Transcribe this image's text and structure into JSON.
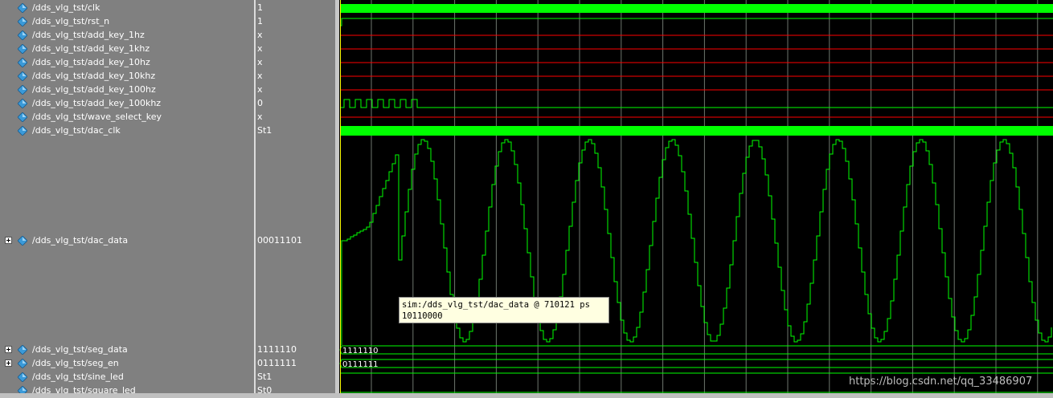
{
  "signals": [
    {
      "name": "/dds_vlg_tst/clk",
      "value": "1",
      "expandable": false
    },
    {
      "name": "/dds_vlg_tst/rst_n",
      "value": "1",
      "expandable": false
    },
    {
      "name": "/dds_vlg_tst/add_key_1hz",
      "value": "x",
      "expandable": false
    },
    {
      "name": "/dds_vlg_tst/add_key_1khz",
      "value": "x",
      "expandable": false
    },
    {
      "name": "/dds_vlg_tst/add_key_10hz",
      "value": "x",
      "expandable": false
    },
    {
      "name": "/dds_vlg_tst/add_key_10khz",
      "value": "x",
      "expandable": false
    },
    {
      "name": "/dds_vlg_tst/add_key_100hz",
      "value": "x",
      "expandable": false
    },
    {
      "name": "/dds_vlg_tst/add_key_100khz",
      "value": "0",
      "expandable": false
    },
    {
      "name": "/dds_vlg_tst/wave_select_key",
      "value": "x",
      "expandable": false
    },
    {
      "name": "/dds_vlg_tst/dac_clk",
      "value": "St1",
      "expandable": false
    },
    {
      "name": "/dds_vlg_tst/dac_data",
      "value": "00011101",
      "expandable": true
    },
    {
      "name": "/dds_vlg_tst/seg_data",
      "value": "1111110",
      "expandable": true
    },
    {
      "name": "/dds_vlg_tst/seg_en",
      "value": "0111111",
      "expandable": true
    },
    {
      "name": "/dds_vlg_tst/sine_led",
      "value": "St1",
      "expandable": false
    },
    {
      "name": "/dds_vlg_tst/square_led",
      "value": "St0",
      "expandable": false
    }
  ],
  "bus_labels": {
    "seg_data": "1111110",
    "seg_en": "0111111"
  },
  "tooltip": {
    "line1": "sim:/dds_vlg_tst/dac_data @ 710121 ps",
    "line2": "10110000"
  },
  "watermark": "https://blog.csdn.net/qq_33486907",
  "colors": {
    "wave_green": "#00ff00",
    "wave_red": "#ff0000",
    "grid": "#c8d8c8",
    "cursor": "#ffff00",
    "panel": "#808080"
  },
  "icons": {
    "signal": "diamond-signal-icon",
    "expand": "plus-expander-icon"
  }
}
